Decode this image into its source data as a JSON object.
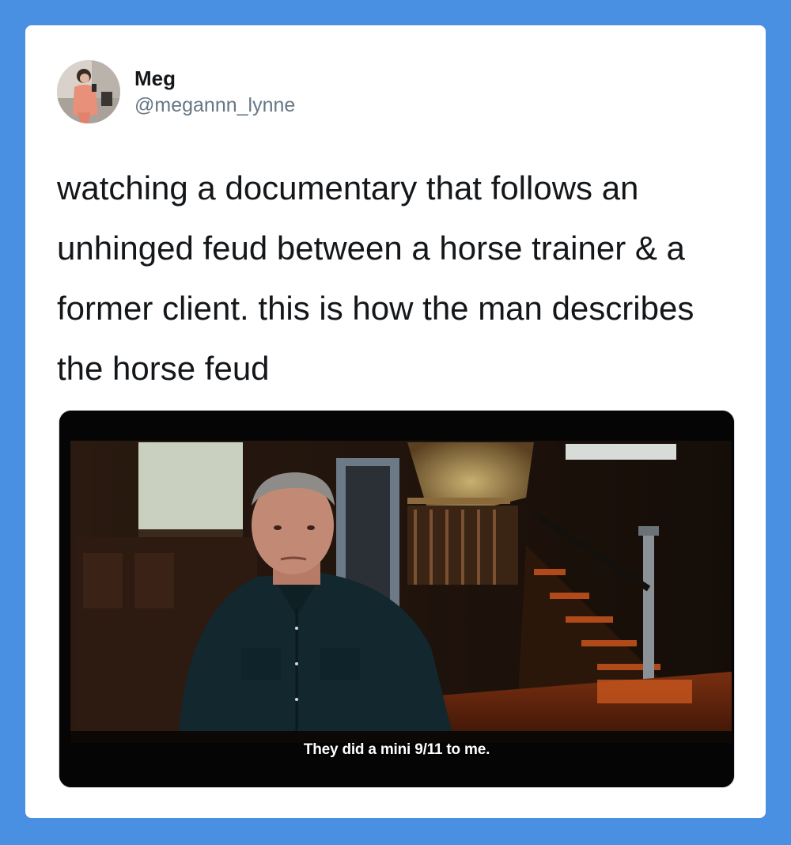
{
  "tweet": {
    "display_name": "Meg",
    "handle": "@megannn_lynne",
    "text": "watching a documentary that follows an unhinged feud between a horse trainer & a former client. this is how the man describes the horse feud",
    "avatar_icon": "profile-photo",
    "media": {
      "subtitle": "They did a mini 9/11 to me."
    }
  },
  "colors": {
    "background": "#4a90e2",
    "card": "#ffffff",
    "text_primary": "#14171a",
    "text_secondary": "#657786"
  }
}
